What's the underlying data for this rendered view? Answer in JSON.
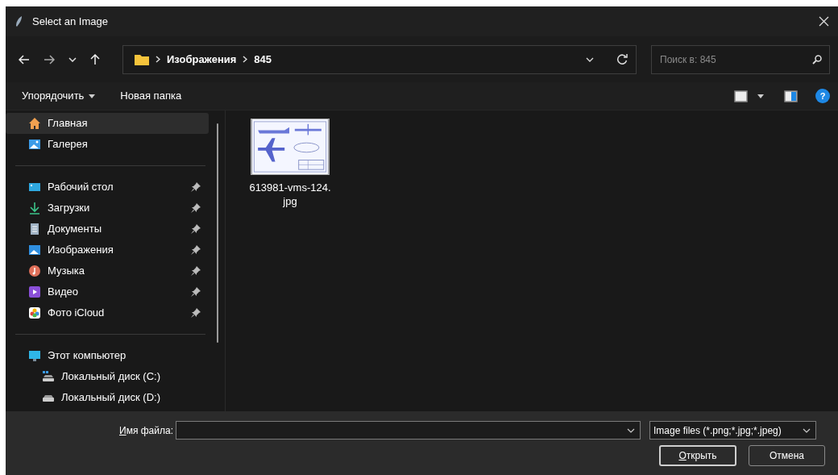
{
  "window": {
    "title": "Select an Image"
  },
  "navigation": {
    "path": [
      "Изображения",
      "845"
    ],
    "search_placeholder": "Поиск в: 845"
  },
  "toolbar": {
    "organize": "Упорядочить",
    "new_folder": "Новая папка",
    "help": "?"
  },
  "sidebar": {
    "groups": [
      {
        "items": [
          {
            "kind": "home",
            "label": "Главная",
            "selected": true,
            "pinned": false
          },
          {
            "kind": "gallery",
            "label": "Галерея",
            "selected": false,
            "pinned": false
          }
        ]
      },
      {
        "items": [
          {
            "kind": "desktop",
            "label": "Рабочий стол",
            "selected": false,
            "pinned": true
          },
          {
            "kind": "downloads",
            "label": "Загрузки",
            "selected": false,
            "pinned": true
          },
          {
            "kind": "documents",
            "label": "Документы",
            "selected": false,
            "pinned": true
          },
          {
            "kind": "pictures",
            "label": "Изображения",
            "selected": false,
            "pinned": true
          },
          {
            "kind": "music",
            "label": "Музыка",
            "selected": false,
            "pinned": true
          },
          {
            "kind": "video",
            "label": "Видео",
            "selected": false,
            "pinned": true
          },
          {
            "kind": "icloud",
            "label": "Фото iCloud",
            "selected": false,
            "pinned": true
          }
        ]
      },
      {
        "items": [
          {
            "kind": "computer",
            "label": "Этот компьютер",
            "selected": false,
            "pinned": false,
            "children": [
              {
                "kind": "system_disk",
                "label": "Локальный диск (C:)",
                "selected": false,
                "pinned": false
              },
              {
                "kind": "disk",
                "label": "Локальный диск (D:)",
                "selected": false,
                "pinned": false
              }
            ]
          }
        ]
      }
    ]
  },
  "files": [
    {
      "kind": "picture",
      "name": "613981-vms-124.\njpg",
      "selected": false
    }
  ],
  "footer": {
    "filename_label": {
      "mnemonic": "И",
      "rest": "мя файла:"
    },
    "filter": "Image files (*.png;*.jpg;*.jpeg)",
    "open_button": {
      "mnemonic": "О",
      "rest": "ткрыть"
    },
    "cancel_button": "Отмена"
  }
}
